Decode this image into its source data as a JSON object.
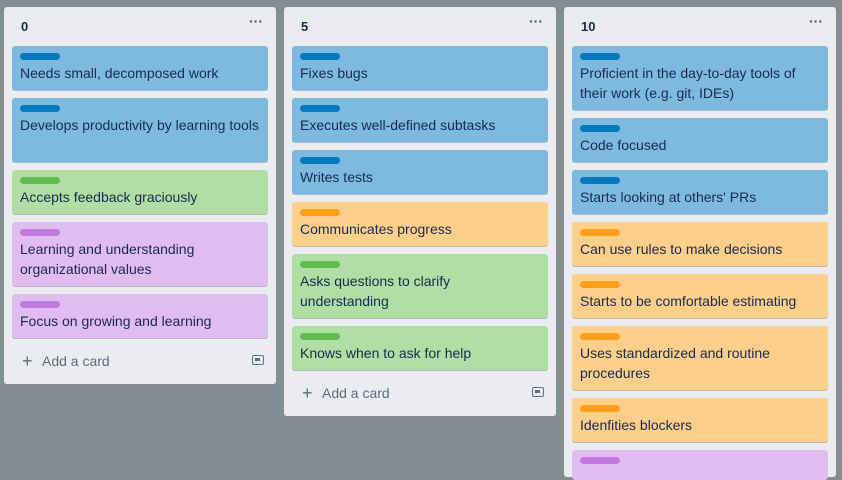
{
  "board": {
    "lists": [
      {
        "title": "0",
        "menu_icon": "ellipsis-icon",
        "add_card_label": "Add a card",
        "cards": [
          {
            "text": "Needs small, decomposed work",
            "color": "blue"
          },
          {
            "text": "Develops productivity by learning tools",
            "color": "blue"
          },
          {
            "text": "Accepts feedback graciously",
            "color": "green"
          },
          {
            "text": "Learning and understanding organizational values",
            "color": "purple"
          },
          {
            "text": "Focus on growing and learning",
            "color": "purple"
          }
        ]
      },
      {
        "title": "5",
        "menu_icon": "ellipsis-icon",
        "add_card_label": "Add a card",
        "cards": [
          {
            "text": "Fixes bugs",
            "color": "blue"
          },
          {
            "text": "Executes well-defined subtasks",
            "color": "blue"
          },
          {
            "text": "Writes tests",
            "color": "blue"
          },
          {
            "text": "Communicates progress",
            "color": "orange"
          },
          {
            "text": "Asks questions to clarify understanding",
            "color": "green"
          },
          {
            "text": "Knows when to ask for help",
            "color": "green"
          }
        ]
      },
      {
        "title": "10",
        "menu_icon": "ellipsis-icon",
        "cards": [
          {
            "text": "Proficient in the day-to-day tools of their work (e.g. git, IDEs)",
            "color": "blue"
          },
          {
            "text": "Code focused",
            "color": "blue"
          },
          {
            "text": "Starts looking at others' PRs",
            "color": "blue"
          },
          {
            "text": "Can use rules to make decisions",
            "color": "orange"
          },
          {
            "text": "Starts to be comfortable estimating",
            "color": "orange"
          },
          {
            "text": "Uses standardized and routine procedures",
            "color": "orange"
          },
          {
            "text": "Idenfities blockers",
            "color": "orange"
          },
          {
            "text": "",
            "color": "purple"
          }
        ]
      }
    ]
  },
  "colors": {
    "board_background": "#858d94",
    "list_background": "#ebecf0",
    "blue_card": "#7ebae0",
    "green_card": "#b0dea5",
    "orange_card": "#fecf8a",
    "purple_card": "#e1bcf1"
  }
}
